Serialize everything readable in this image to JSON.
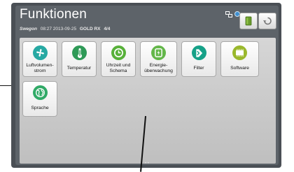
{
  "header": {
    "title": "Funktionen",
    "brand": "Swegon",
    "datetime": "08:27 2013-09-25",
    "model": "GOLD RX",
    "unit_index": "4/4"
  },
  "tiles": [
    {
      "label_line1": "Luftvolumen-",
      "label_line2": "strom",
      "icon": "fan-icon",
      "color": "#27a9a3"
    },
    {
      "label_line1": "Temperatur",
      "label_line2": "",
      "icon": "thermometer-icon",
      "color": "#2f9a57"
    },
    {
      "label_line1": "Uhrzeit und",
      "label_line2": "Schema",
      "icon": "clock-icon",
      "color": "#58b13a"
    },
    {
      "label_line1": "Energie-",
      "label_line2": "überwachung",
      "icon": "energy-icon",
      "color": "#64b74a"
    },
    {
      "label_line1": "Filter",
      "label_line2": "",
      "icon": "filter-icon",
      "color": "#16a188"
    },
    {
      "label_line1": "Software",
      "label_line2": "",
      "icon": "chip-icon",
      "color": "#9ab82c"
    },
    {
      "label_line1": "Sprache",
      "label_line2": "",
      "icon": "globe-icon",
      "color": "#31aa67"
    }
  ]
}
